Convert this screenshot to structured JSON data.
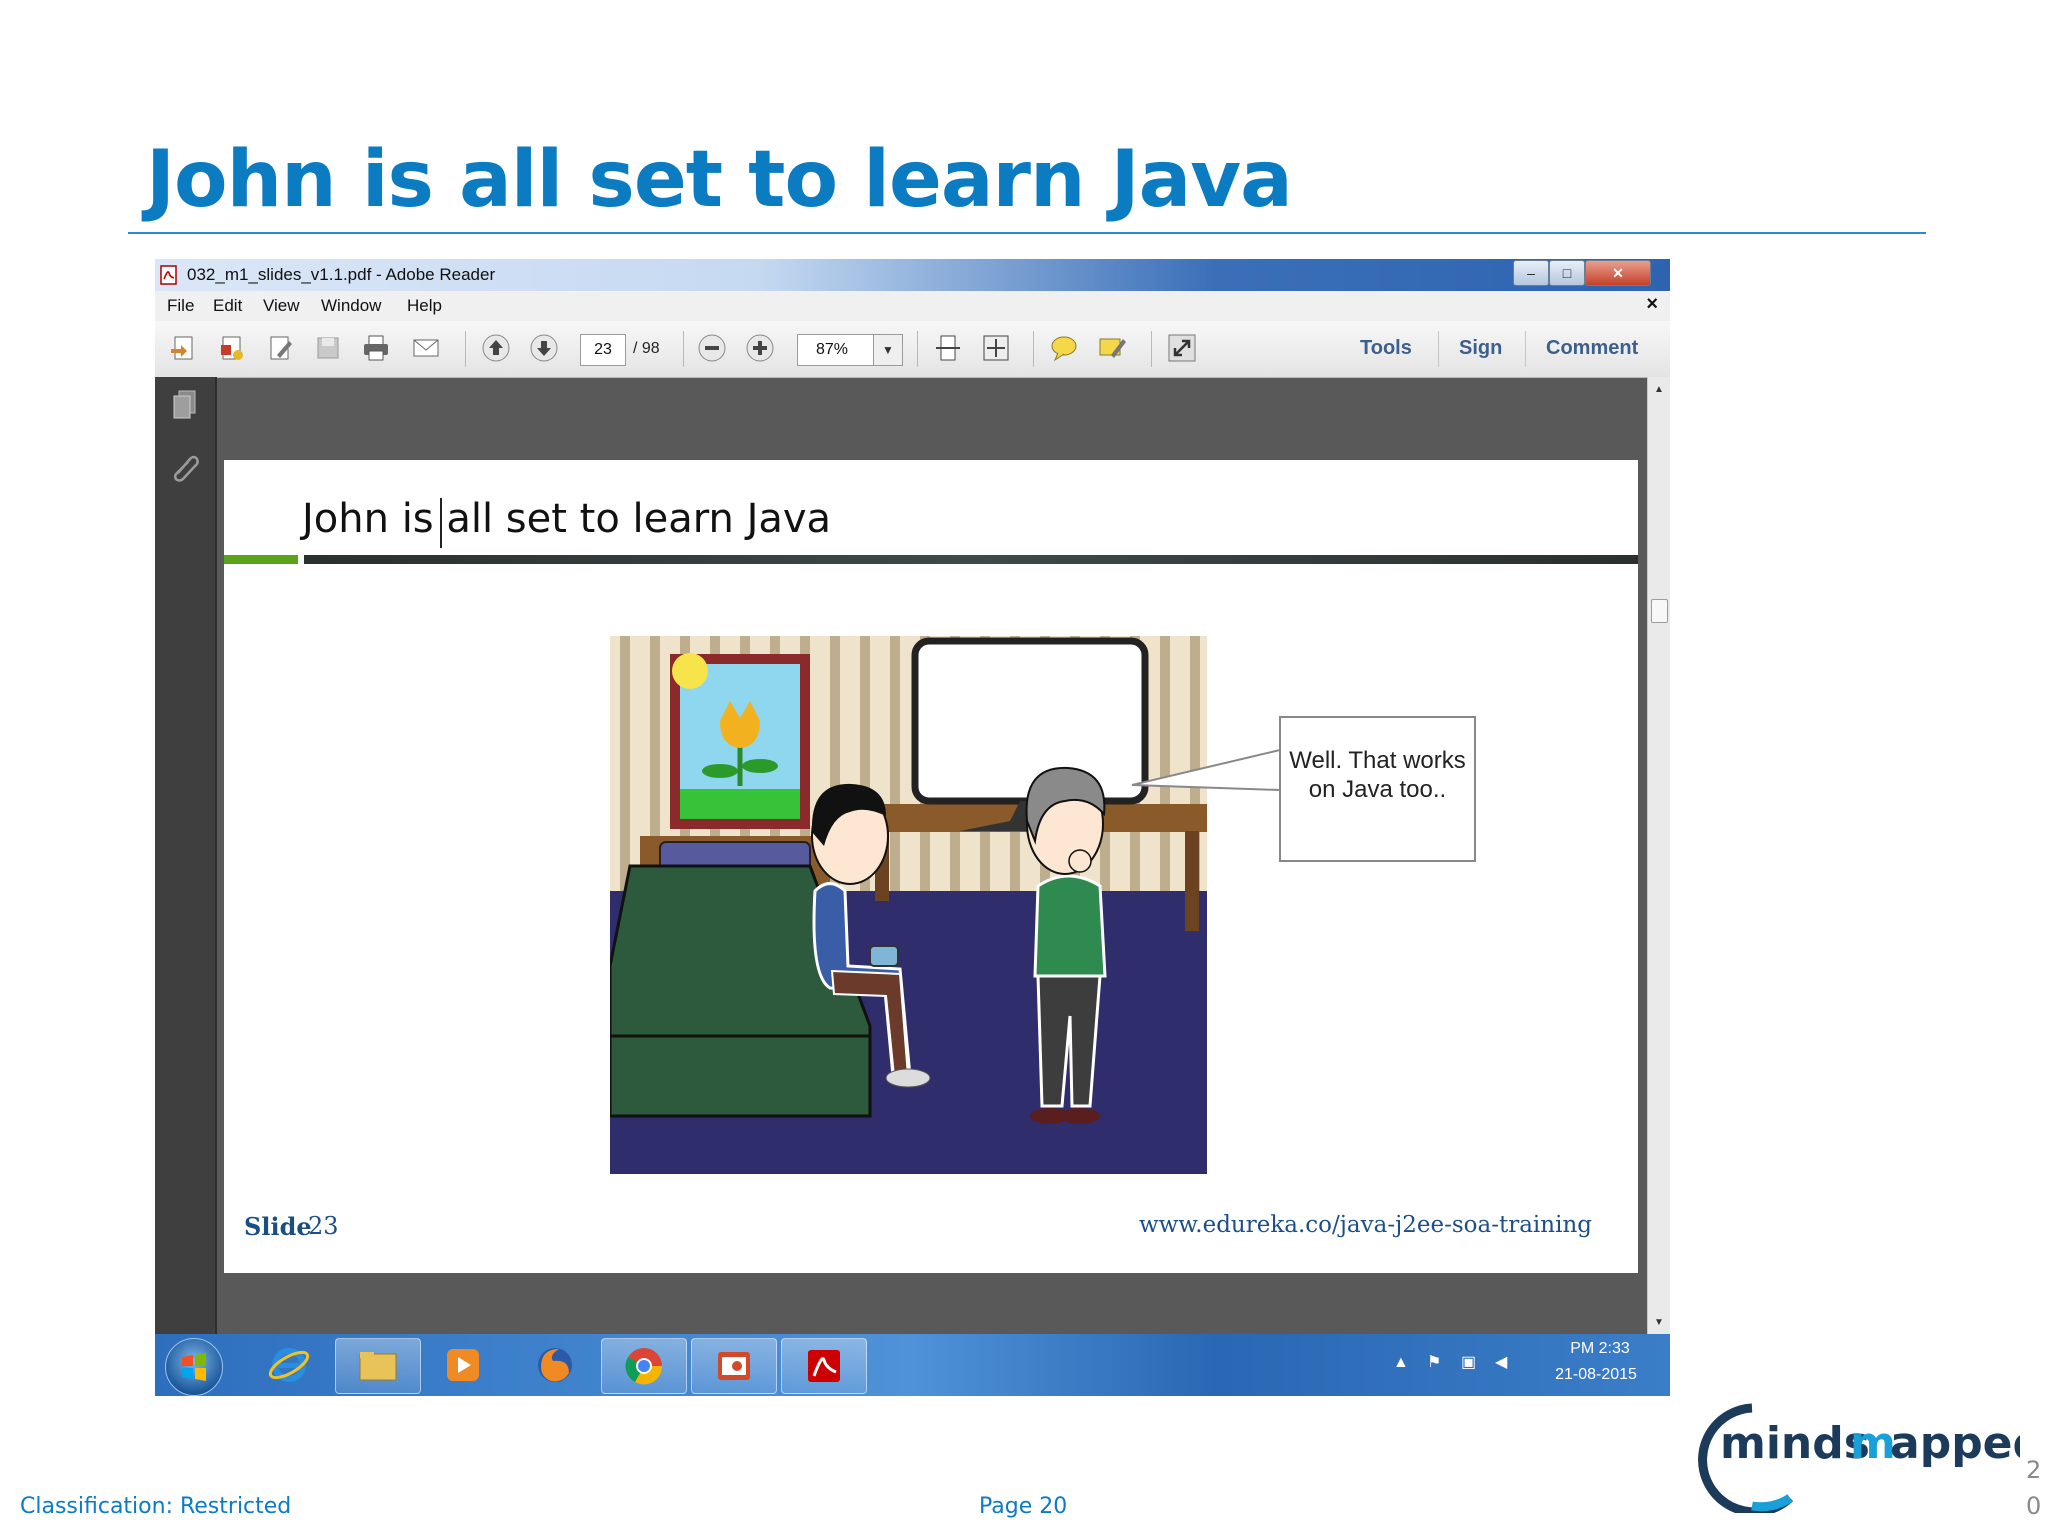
{
  "slide": {
    "title": "John is all set to learn Java",
    "footer_classification": "Classification: Restricted",
    "footer_page": "Page 20",
    "slide_counter": "20",
    "logo_text": "mindsmapped"
  },
  "window": {
    "title": "032_m1_slides_v1.1.pdf - Adobe Reader",
    "buttons": {
      "minimize": "–",
      "maximize": "□",
      "close": "✕"
    }
  },
  "menu": {
    "items": [
      "File",
      "Edit",
      "View",
      "Window",
      "Help"
    ],
    "close": "×"
  },
  "toolbar": {
    "current_page": "23",
    "total_pages": "/ 98",
    "zoom": "87%",
    "links": [
      "Tools",
      "Sign",
      "Comment"
    ]
  },
  "pdf_page": {
    "title": "John is all set to learn Java",
    "speech_bubble": "Well. That works on Java too..",
    "slide_label": "Slide",
    "slide_number": "23",
    "url": "www.edureka.co/java-j2ee-soa-training"
  },
  "taskbar": {
    "apps": [
      "internet-explorer",
      "file-explorer",
      "media-player",
      "firefox",
      "chrome",
      "presentation",
      "adobe-reader"
    ],
    "clock_time": "PM 2:33",
    "clock_date": "21-08-2015"
  },
  "colors": {
    "accent": "#0b7bc2",
    "pdf_link": "#1c4f8a",
    "taskbar": "#3b7ec8"
  }
}
